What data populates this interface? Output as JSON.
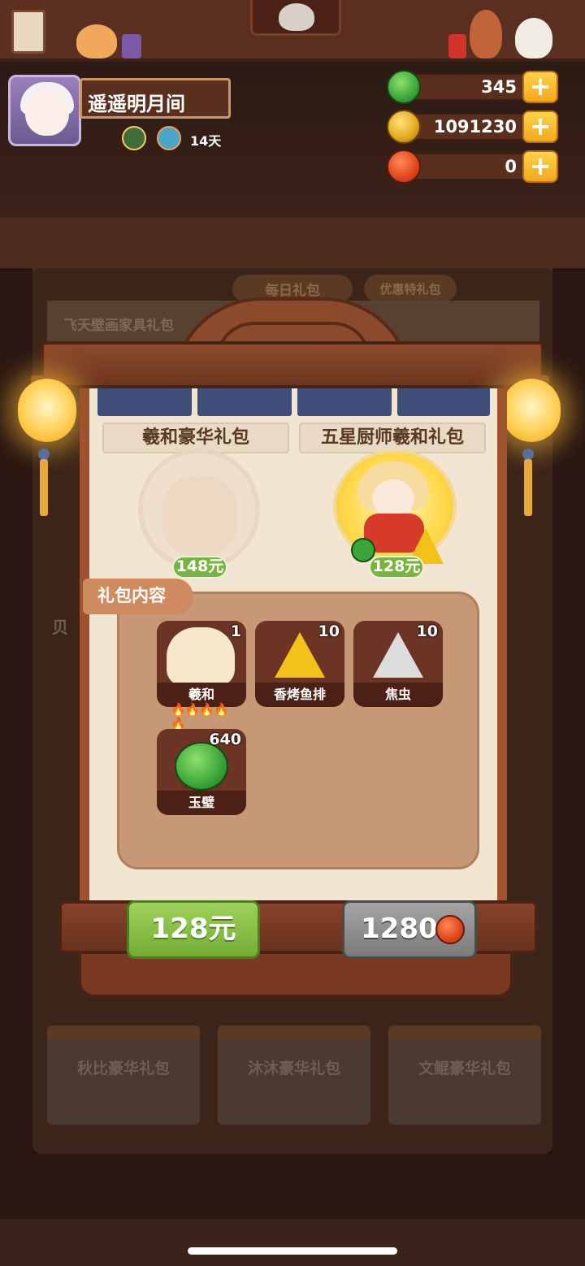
{
  "player": {
    "name": "遥遥明月间",
    "days_label": "14天"
  },
  "currencies": [
    {
      "icon": "jade-icon",
      "value": "345",
      "color": "#3aa63a"
    },
    {
      "icon": "gold-coin-icon",
      "value": "1091230",
      "color": "#e2a818"
    },
    {
      "icon": "red-apple-icon",
      "value": "0",
      "color": "#e0441a"
    }
  ],
  "plus_label": "+",
  "background": {
    "tabs": [
      "每日礼包",
      "优惠特礼包"
    ],
    "banner": "飞天壁画家具礼包",
    "left_edge_text": "贝",
    "cards": [
      "秋比豪华礼包",
      "沐沐豪华礼包",
      "文鲲豪华礼包"
    ]
  },
  "modal": {
    "packs": [
      {
        "title": "羲和豪华礼包",
        "price": "148元",
        "selected": false
      },
      {
        "title": "五星厨师羲和礼包",
        "price": "128元",
        "selected": true
      }
    ],
    "contents_label": "礼包内容",
    "items": [
      {
        "name": "羲和",
        "count": "1",
        "icon": "xihe-character-icon",
        "rating": "5 flames"
      },
      {
        "name": "香烤鱼排",
        "count": "10",
        "icon": "gold-zongzi-fish-icon"
      },
      {
        "name": "焦虫",
        "count": "10",
        "icon": "silver-zongzi-bug-icon"
      },
      {
        "name": "玉璧",
        "count": "640",
        "icon": "jade-disc-icon"
      }
    ],
    "buy_button": "128元",
    "alt_button": "1280"
  },
  "colors": {
    "buy_green": "#86c045",
    "disabled_gray": "#8f8f8f",
    "wood_brown": "#8a4a2b",
    "paper": "#f2e6d2",
    "contents_panel": "#c69876"
  }
}
